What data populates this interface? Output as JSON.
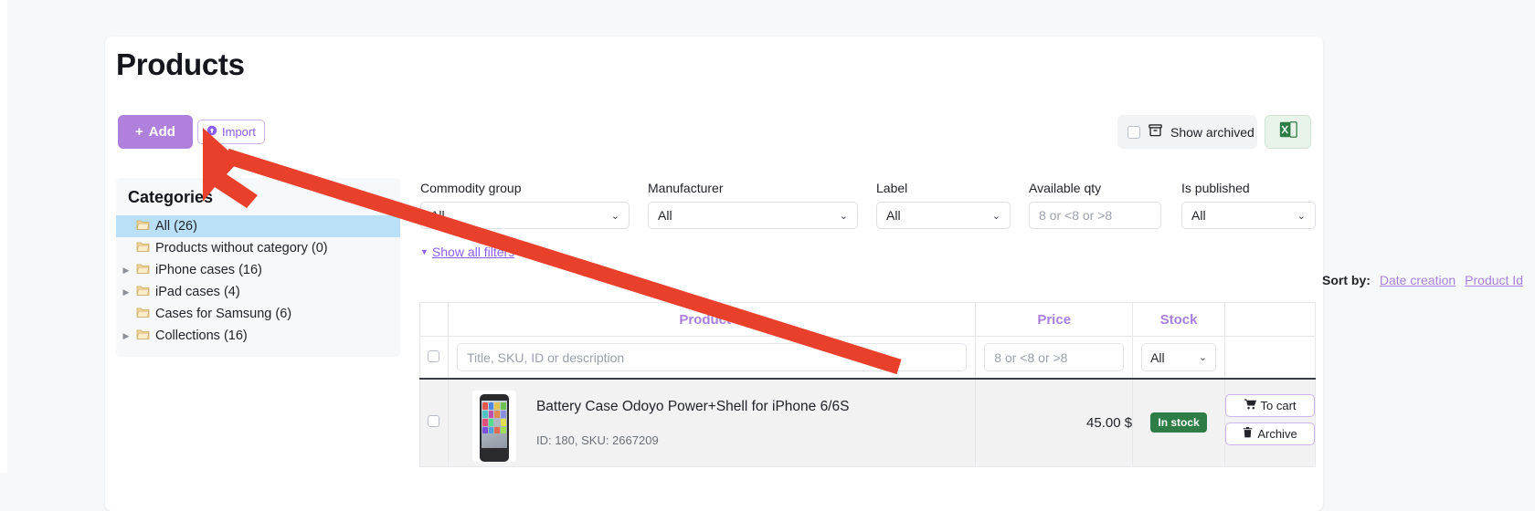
{
  "page": {
    "title": "Products"
  },
  "toolbar": {
    "add_label": "Add",
    "add_icon": "plus-icon",
    "import_label": "Import",
    "import_icon": "upload-icon",
    "show_archived_label": "Show archived",
    "archive_icon": "archive-box-icon",
    "excel_icon": "excel-export-icon",
    "excel_label": "X"
  },
  "categories": {
    "title": "Categories",
    "items": [
      {
        "label": "All (26)",
        "selected": true,
        "expandable": false
      },
      {
        "label": "Products without category (0)",
        "selected": false,
        "expandable": false
      },
      {
        "label": "iPhone cases (16)",
        "selected": false,
        "expandable": true
      },
      {
        "label": "iPad cases (4)",
        "selected": false,
        "expandable": true
      },
      {
        "label": "Cases for Samsung (6)",
        "selected": false,
        "expandable": false
      },
      {
        "label": "Collections (16)",
        "selected": false,
        "expandable": true
      }
    ]
  },
  "filters": {
    "commodity_group": {
      "label": "Commodity group",
      "value": "All"
    },
    "manufacturer": {
      "label": "Manufacturer",
      "value": "All"
    },
    "label": {
      "label": "Label",
      "value": "All"
    },
    "available_qty": {
      "label": "Available qty",
      "placeholder": "8 or <8 or >8"
    },
    "is_published": {
      "label": "Is published",
      "value": "All"
    },
    "show_all_link": "Show all filters"
  },
  "sort": {
    "label": "Sort by:",
    "options": [
      "Date creation",
      "Product Id"
    ]
  },
  "table": {
    "headers": {
      "product": "Product",
      "product_sort_dir": "▲",
      "price": "Price",
      "stock": "Stock"
    },
    "filter_row": {
      "search_placeholder": "Title, SKU, ID or description",
      "price_placeholder": "8 or <8 or >8",
      "stock_value": "All"
    },
    "rows": [
      {
        "title": "Battery Case Odoyo Power+Shell for iPhone 6/6S",
        "meta": "ID: 180, SKU: 2667209",
        "price": "45.00 $",
        "stock_badge": "In stock",
        "actions": [
          {
            "label": "To cart",
            "icon": "cart-icon"
          },
          {
            "label": "Archive",
            "icon": "trash-icon"
          }
        ]
      }
    ]
  },
  "colors": {
    "accent": "#8b5cf6",
    "add_button": "#b080dd",
    "header_purple": "#a87fdc",
    "in_stock": "#2f7d46",
    "selection": "#b9e0f7",
    "annotation_arrow": "#e8402a"
  }
}
